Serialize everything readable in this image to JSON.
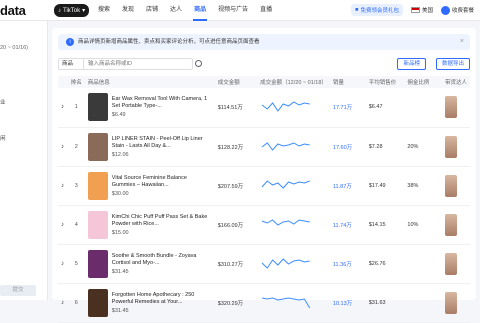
{
  "header": {
    "logo": "data",
    "platform": "TikTok",
    "nav": [
      "搜索",
      "发现",
      "店铺",
      "达人",
      "商品",
      "视频与广告",
      "直播"
    ],
    "active_nav": 4,
    "promo": "免费领会员礼包",
    "region": "美国",
    "account": "收费套餐"
  },
  "sidebar": {
    "date_range": "20 ~ 01/16)",
    "items": [
      "业",
      "",
      "闲",
      "",
      "",
      "",
      ""
    ],
    "button": "提交"
  },
  "banner": {
    "text": "商品详情页新增商品属性、卖点和买家评论分析，可点进任意商品页面查看",
    "close": "×"
  },
  "search": {
    "scope": "商品",
    "placeholder": "输入商品名称或ID",
    "btn_new": "新品榜",
    "btn_fav": "数据导出"
  },
  "table": {
    "columns": [
      "",
      "排名",
      "商品信息",
      "成交金额",
      "成交金额（12/20 ~ 01/18）",
      "销量",
      "平均销售价",
      "佣金比例",
      "带货达人"
    ],
    "rows": [
      {
        "rank": "1",
        "title": "Ear Wax Removal Tool With Camera, 1 Set Portable Type-...",
        "price": "$6.49",
        "gmv": "$114.51万",
        "sales": "17.71万",
        "avg": "$6.47",
        "commission": "",
        "color": "#3a3a3a"
      },
      {
        "rank": "2",
        "title": "LIP LINER STAIN - Peel-Off Lip Liner Stain - Lasts All Day &...",
        "price": "$12.06",
        "gmv": "$128.22万",
        "sales": "17.60万",
        "avg": "$7.28",
        "commission": "20%",
        "color": "#8a6b5a"
      },
      {
        "rank": "3",
        "title": "Vital Source Feminine Balance Gummies – Hawaiian...",
        "price": "$30.00",
        "gmv": "$207.59万",
        "sales": "11.87万",
        "avg": "$17.49",
        "commission": "38%",
        "color": "#f0a050"
      },
      {
        "rank": "4",
        "title": "KimChi Chic Puff Puff Pass Set & Bake Powder with Rice...",
        "price": "$15.00",
        "gmv": "$166.09万",
        "sales": "11.74万",
        "avg": "$14.15",
        "commission": "10%",
        "color": "#f4c6d8"
      },
      {
        "rank": "5",
        "title": "Soothe & Smooth Bundle - Zoyava Cortisol and Myo-...",
        "price": "$31.45",
        "gmv": "$310.27万",
        "sales": "11.36万",
        "avg": "$26.76",
        "commission": "",
        "color": "#6b2c6b"
      },
      {
        "rank": "6",
        "title": "Forgotten Home Apothecary : 250 Powerful Remedies at Your...",
        "price": "$31.45",
        "gmv": "$320.29万",
        "sales": "10.13万",
        "avg": "$31.63",
        "commission": "",
        "color": "#4a3020"
      }
    ]
  },
  "colors": {
    "accent": "#2f6bff",
    "spark": "#3a8dff"
  }
}
